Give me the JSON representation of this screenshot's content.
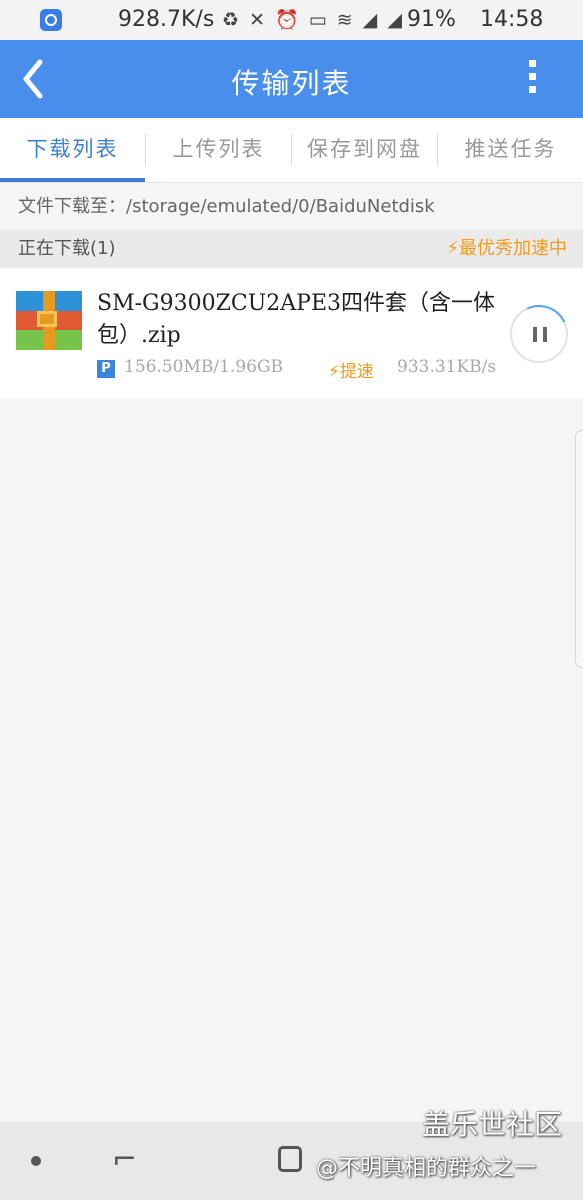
{
  "status_bar": {
    "network_speed": "928.7K/s",
    "battery": "91%",
    "time": "14:58"
  },
  "header": {
    "back_icon": "chevron-left",
    "title": "传输列表",
    "more_icon": "more-vertical"
  },
  "tabs": [
    {
      "label": "下载列表",
      "active": true
    },
    {
      "label": "上传列表",
      "active": false
    },
    {
      "label": "保存到网盘",
      "active": false
    },
    {
      "label": "推送任务",
      "active": false
    }
  ],
  "download_path": "文件下载至：/storage/emulated/0/BaiduNetdisk",
  "section": {
    "title": "正在下载(1)",
    "boost_status": "⚡最优秀加速中"
  },
  "downloads": [
    {
      "icon": "zip-archive-icon",
      "name": "SM-G9300ZCU2APE3四件套（含一体包）.zip",
      "badge": "P",
      "size": "156.50MB/1.96GB",
      "boost_label": "⚡提速",
      "speed": "933.31KB/s",
      "state": "downloading",
      "control_icon": "pause"
    }
  ],
  "nav_bar": {
    "recent_glyph": "⌐"
  },
  "watermark": {
    "line1": "盖乐世社区",
    "line2": "@不明真相的群众之一"
  },
  "colors": {
    "accent": "#4a8eec",
    "tab_active": "#3c7fd3",
    "boost": "#f39a1b"
  }
}
